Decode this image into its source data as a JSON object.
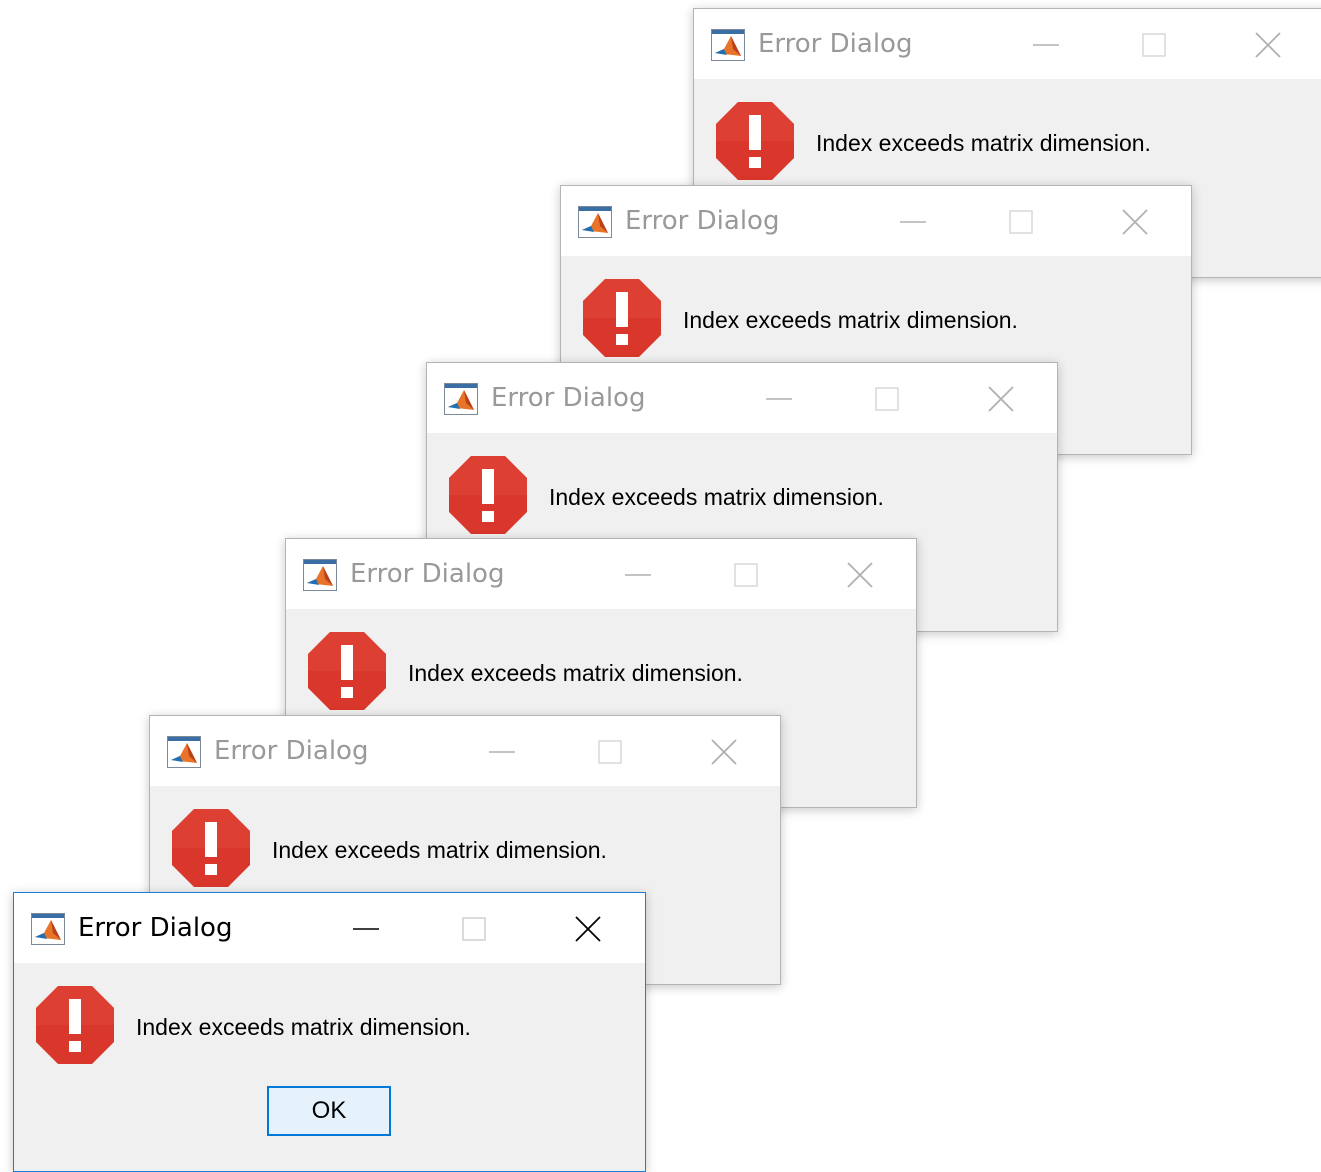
{
  "dialogs": [
    {
      "title": "Error Dialog",
      "message": "Index exceeds matrix dimension.",
      "active": false
    },
    {
      "title": "Error Dialog",
      "message": "Index exceeds matrix dimension.",
      "active": false
    },
    {
      "title": "Error Dialog",
      "message": "Index exceeds matrix dimension.",
      "active": false
    },
    {
      "title": "Error Dialog",
      "message": "Index exceeds matrix dimension.",
      "active": false
    },
    {
      "title": "Error Dialog",
      "message": "Index exceeds matrix dimension.",
      "active": false
    },
    {
      "title": "Error Dialog",
      "message": "Index exceeds matrix dimension.",
      "active": true,
      "ok_label": "OK"
    }
  ],
  "icons": {
    "app": "matlab-logo-icon",
    "error": "error-octagon-icon",
    "minimize": "minimize-icon",
    "maximize": "maximize-icon",
    "close": "close-icon"
  },
  "colors": {
    "error_red": "#d9372b",
    "active_border": "#1c7cd6",
    "inactive_title": "#999999",
    "dialog_bg": "#f0f0f0"
  }
}
